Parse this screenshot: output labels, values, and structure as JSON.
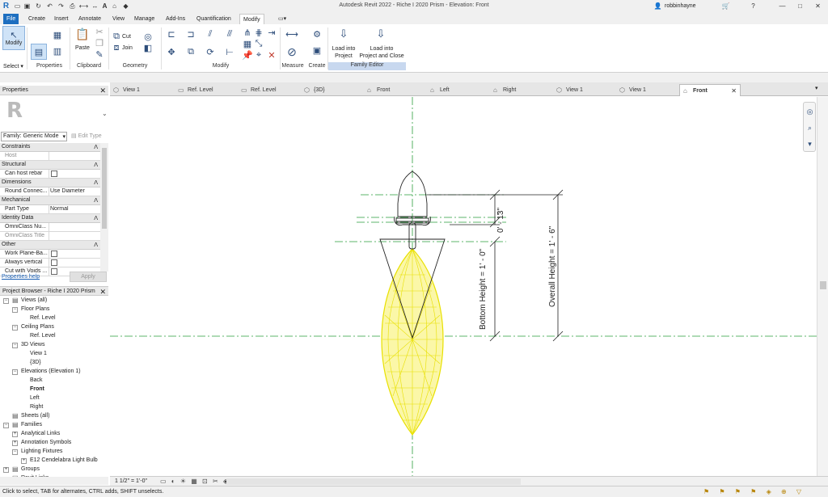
{
  "window": {
    "title": "Autodesk Revit 2022 - Riche I 2020 Prism - Elevation: Front",
    "user": "robbinhayne"
  },
  "menu": [
    "File",
    "Create",
    "Insert",
    "Annotate",
    "View",
    "Manage",
    "Add-Ins",
    "Quantification",
    "Modify"
  ],
  "ribbon": {
    "modify_label": "Modify",
    "select_label": "Select ▾",
    "panels": {
      "properties": "Properties",
      "clipboard": "Clipboard",
      "geometry": "Geometry",
      "modify": "Modify",
      "measure": "Measure",
      "create": "Create",
      "family_editor": "Family Editor"
    },
    "paste": "Paste",
    "cut": "Cut",
    "join": "Join",
    "load_into_project": [
      "Load into",
      "Project"
    ],
    "load_into_project_close": [
      "Load into",
      "Project and Close"
    ]
  },
  "doc_tabs": [
    {
      "label": "View 1",
      "icon": "3d-view-icon"
    },
    {
      "label": "Ref. Level",
      "icon": "plan-icon"
    },
    {
      "label": "Ref. Level",
      "icon": "plan-icon"
    },
    {
      "label": "{3D}",
      "icon": "3d-view-icon"
    },
    {
      "label": "Front",
      "icon": "elevation-icon"
    },
    {
      "label": "Left",
      "icon": "elevation-icon"
    },
    {
      "label": "Right",
      "icon": "elevation-icon"
    },
    {
      "label": "View 1",
      "icon": "3d-view-icon"
    },
    {
      "label": "View 1",
      "icon": "3d-view-icon"
    },
    {
      "label": "Front",
      "icon": "elevation-icon",
      "active": true
    }
  ],
  "properties": {
    "title": "Properties",
    "type_selector": "Family: Generic Mode",
    "edit_type": "Edit Type",
    "rows": [
      {
        "cat": "Constraints"
      },
      {
        "k": "Host",
        "v": "",
        "grey": true
      },
      {
        "cat": "Structural"
      },
      {
        "k": "Can host rebar",
        "cb": true
      },
      {
        "cat": "Dimensions"
      },
      {
        "k": "Round Connec...",
        "v": "Use Diameter"
      },
      {
        "cat": "Mechanical"
      },
      {
        "k": "Part Type",
        "v": "Normal"
      },
      {
        "cat": "Identity Data"
      },
      {
        "k": "OmniClass Nu...",
        "v": ""
      },
      {
        "k": "OmniClass Title",
        "v": "",
        "grey": true
      },
      {
        "cat": "Other"
      },
      {
        "k": "Work Plane-Ba...",
        "cb": true
      },
      {
        "k": "Always vertical",
        "cb": true
      },
      {
        "k": "Cut with Voids ...",
        "cb": true
      }
    ],
    "help": "Properties help",
    "apply": "Apply"
  },
  "browser": {
    "title": "Project Browser - Riche I 2020 Prism",
    "nodes": [
      {
        "d": 0,
        "t": "Views (all)",
        "ex": "−",
        "ic": "views-icon"
      },
      {
        "d": 1,
        "t": "Floor Plans",
        "ex": "−"
      },
      {
        "d": 2,
        "t": "Ref. Level"
      },
      {
        "d": 1,
        "t": "Ceiling Plans",
        "ex": "−"
      },
      {
        "d": 2,
        "t": "Ref. Level"
      },
      {
        "d": 1,
        "t": "3D Views",
        "ex": "−"
      },
      {
        "d": 2,
        "t": "View 1"
      },
      {
        "d": 2,
        "t": "{3D}"
      },
      {
        "d": 1,
        "t": "Elevations (Elevation 1)",
        "ex": "−"
      },
      {
        "d": 2,
        "t": "Back"
      },
      {
        "d": 2,
        "t": "Front",
        "bold": true
      },
      {
        "d": 2,
        "t": "Left"
      },
      {
        "d": 2,
        "t": "Right"
      },
      {
        "d": 0,
        "t": "Sheets (all)",
        "ic": "sheets-icon"
      },
      {
        "d": 0,
        "t": "Families",
        "ex": "−",
        "ic": "families-icon"
      },
      {
        "d": 1,
        "t": "Analytical Links",
        "ex": "+"
      },
      {
        "d": 1,
        "t": "Annotation Symbols",
        "ex": "+"
      },
      {
        "d": 1,
        "t": "Lighting Fixtures",
        "ex": "−"
      },
      {
        "d": 2,
        "t": "E12 Cendelabra Light Bulb",
        "ex": "+"
      },
      {
        "d": 0,
        "t": "Groups",
        "ex": "+",
        "ic": "groups-icon"
      },
      {
        "d": 0,
        "t": "Revit Links",
        "ic": "links-icon"
      }
    ]
  },
  "dims": {
    "d1": "0' - 1\"",
    "d2": "3\"",
    "bottom": "Bottom Height = 1' - 0\"",
    "overall": "Overall Height = 1' - 6\""
  },
  "scale": "1 1/2\" = 1'-0\"",
  "status": "Click to select, TAB for alternates, CTRL adds, SHIFT unselects."
}
